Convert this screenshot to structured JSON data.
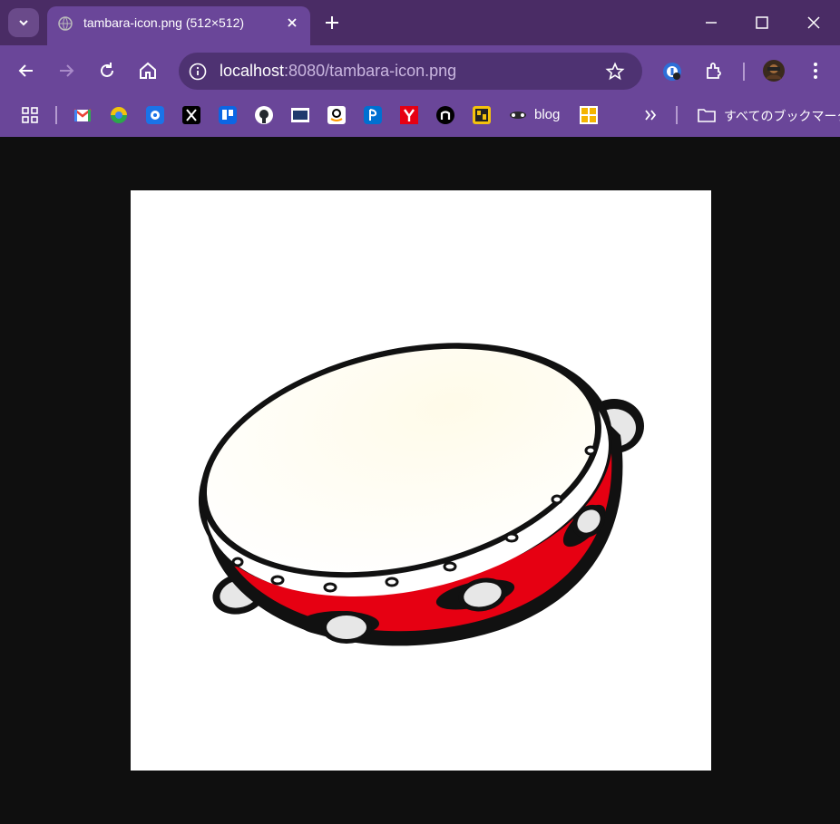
{
  "tab": {
    "title": "tambara-icon.png (512×512)"
  },
  "omnibox": {
    "host": "localhost",
    "rest": ":8080/tambara-icon.png"
  },
  "bookmarks": {
    "items": [
      "apps-icon",
      "gmail-icon",
      "chrome-store-icon",
      "blue-app-icon",
      "x-icon",
      "trello-icon",
      "github-icon",
      "fia-icon",
      "amazon-icon",
      "playstation-icon",
      "y-icon",
      "n-icon",
      "pb-icon"
    ],
    "blog_label": "blog",
    "all_label": "すべてのブックマーク"
  },
  "colors": {
    "frame": "#4a2c65",
    "toolbar": "#6a4699",
    "omnibox": "#4e3272",
    "page_bg": "#0f0f0f"
  }
}
